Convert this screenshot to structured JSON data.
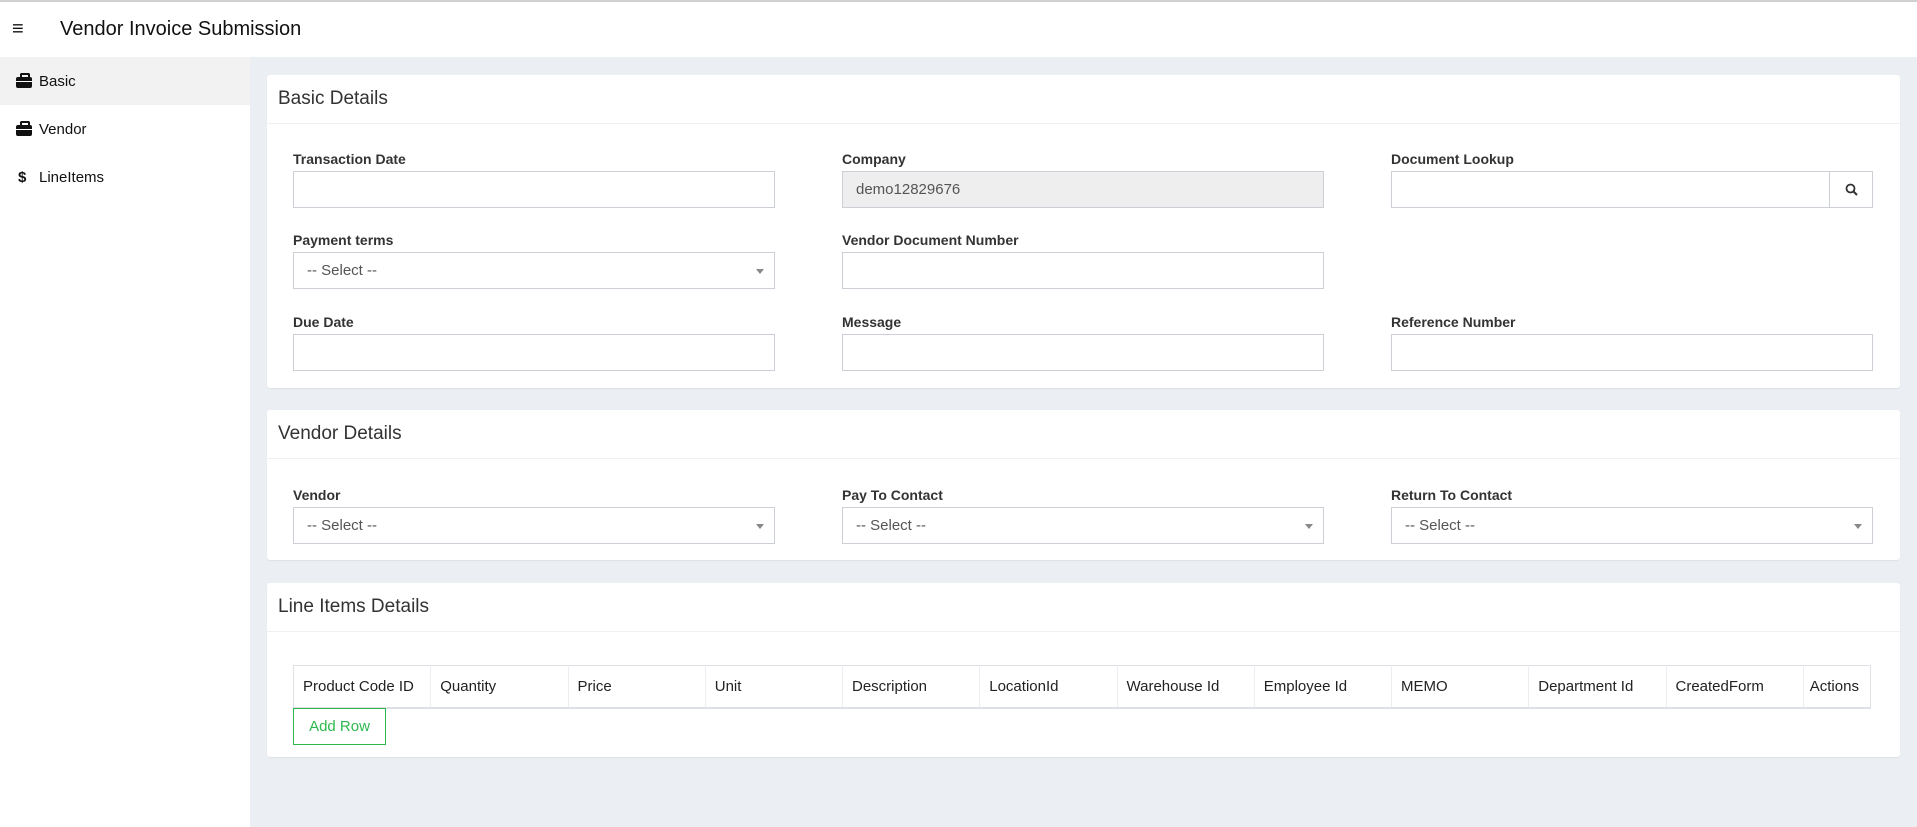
{
  "header": {
    "title": "Vendor Invoice Submission",
    "menu_icon": "hamburger-icon"
  },
  "sidebar": {
    "items": [
      {
        "label": "Basic",
        "icon": "briefcase-icon",
        "active": true
      },
      {
        "label": "Vendor",
        "icon": "briefcase-icon"
      },
      {
        "label": "LineItems",
        "icon": "dollar-icon",
        "glyph": "$"
      }
    ]
  },
  "basic": {
    "title": "Basic Details",
    "transaction_date": {
      "label": "Transaction Date",
      "value": ""
    },
    "company": {
      "label": "Company",
      "value": "demo12829676"
    },
    "document_lookup": {
      "label": "Document Lookup",
      "value": ""
    },
    "payment_terms": {
      "label": "Payment terms",
      "value": "-- Select --"
    },
    "vendor_document_number": {
      "label": "Vendor Document Number",
      "value": ""
    },
    "due_date": {
      "label": "Due Date",
      "value": ""
    },
    "message": {
      "label": "Message",
      "value": ""
    },
    "reference_number": {
      "label": "Reference Number",
      "value": ""
    }
  },
  "vendor": {
    "title": "Vendor Details",
    "vendor": {
      "label": "Vendor",
      "value": "-- Select --"
    },
    "pay_to_contact": {
      "label": "Pay To Contact",
      "value": "-- Select --"
    },
    "return_to_contact": {
      "label": "Return To Contact",
      "value": "-- Select --"
    }
  },
  "line_items": {
    "title": "Line Items Details",
    "columns": [
      "Product Code ID",
      "Quantity",
      "Price",
      "Unit",
      "Description",
      "LocationId",
      "Warehouse Id",
      "Employee Id",
      "MEMO",
      "Department Id",
      "CreatedForm",
      "Actions"
    ],
    "add_row_label": "Add Row"
  },
  "colors": {
    "background": "#ebeef2",
    "accent_green": "#2db84d"
  }
}
